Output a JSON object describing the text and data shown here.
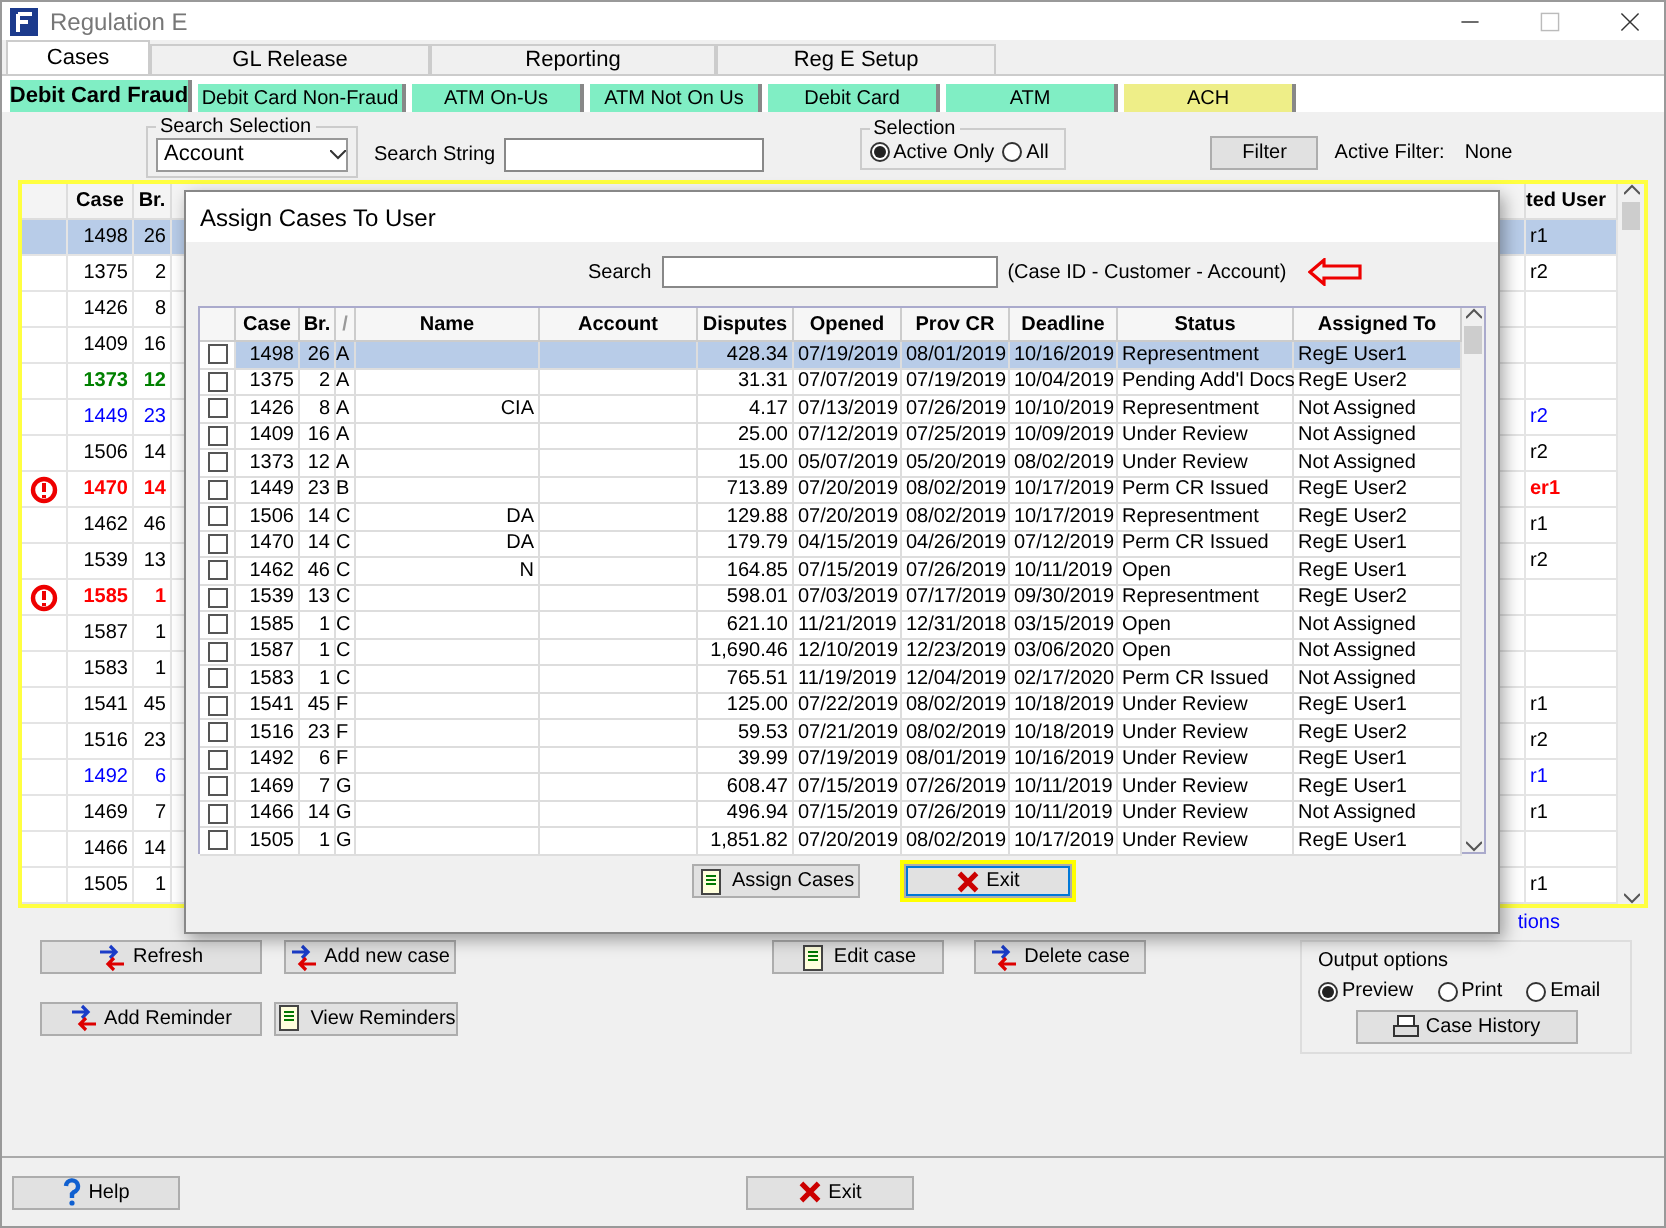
{
  "window": {
    "title": "Regulation E"
  },
  "tabs": [
    {
      "label": "Cases",
      "selected": true
    },
    {
      "label": "GL Release",
      "selected": false
    },
    {
      "label": "Reporting",
      "selected": false
    },
    {
      "label": "Reg E Setup",
      "selected": false
    }
  ],
  "subtabs": [
    {
      "label": "Debit Card Fraud",
      "selected": true,
      "color": "#80eec4"
    },
    {
      "label": "Debit Card Non-Fraud",
      "selected": false,
      "color": "#80eec4"
    },
    {
      "label": "ATM On-Us",
      "selected": false,
      "color": "#80eec4"
    },
    {
      "label": "ATM Not On Us",
      "selected": false,
      "color": "#80eec4"
    },
    {
      "label": "Debit Card",
      "selected": false,
      "color": "#80eec4"
    },
    {
      "label": "ATM",
      "selected": false,
      "color": "#80eec4"
    },
    {
      "label": "ACH",
      "selected": false,
      "color": "#eeee88"
    }
  ],
  "filters": {
    "search_selection": {
      "legend": "Search Selection",
      "value": "Account"
    },
    "search_string": {
      "label": "Search String"
    },
    "selection": {
      "legend": "Selection",
      "options": [
        {
          "label": "Active Only",
          "selected": true
        },
        {
          "label": "All",
          "selected": false
        }
      ]
    },
    "filter_button": "Filter",
    "active_filter": {
      "label": "Active Filter:",
      "value": "None"
    }
  },
  "cases_table": {
    "columns": [
      "Case",
      "Br.",
      "ted User"
    ],
    "rows": [
      {
        "flagged": false,
        "color": "#000000",
        "bold": false,
        "selected": true,
        "case": "1498",
        "br": "26",
        "user": "r1"
      },
      {
        "flagged": false,
        "color": "#000000",
        "bold": false,
        "selected": false,
        "case": "1375",
        "br": "2",
        "user": "r2"
      },
      {
        "flagged": false,
        "color": "#000000",
        "bold": false,
        "selected": false,
        "case": "1426",
        "br": "8",
        "user": ""
      },
      {
        "flagged": false,
        "color": "#000000",
        "bold": false,
        "selected": false,
        "case": "1409",
        "br": "16",
        "user": ""
      },
      {
        "flagged": false,
        "color": "#008000",
        "bold": true,
        "selected": false,
        "case": "1373",
        "br": "12",
        "user": ""
      },
      {
        "flagged": false,
        "color": "#0000ff",
        "bold": false,
        "selected": false,
        "case": "1449",
        "br": "23",
        "user": "r2"
      },
      {
        "flagged": false,
        "color": "#000000",
        "bold": false,
        "selected": false,
        "case": "1506",
        "br": "14",
        "user": "r2"
      },
      {
        "flagged": true,
        "color": "#ff0000",
        "bold": true,
        "selected": false,
        "case": "1470",
        "br": "14",
        "user": "er1"
      },
      {
        "flagged": false,
        "color": "#000000",
        "bold": false,
        "selected": false,
        "case": "1462",
        "br": "46",
        "user": "r1"
      },
      {
        "flagged": false,
        "color": "#000000",
        "bold": false,
        "selected": false,
        "case": "1539",
        "br": "13",
        "user": "r2"
      },
      {
        "flagged": true,
        "color": "#ff0000",
        "bold": true,
        "selected": false,
        "case": "1585",
        "br": "1",
        "user": ""
      },
      {
        "flagged": false,
        "color": "#000000",
        "bold": false,
        "selected": false,
        "case": "1587",
        "br": "1",
        "user": ""
      },
      {
        "flagged": false,
        "color": "#000000",
        "bold": false,
        "selected": false,
        "case": "1583",
        "br": "1",
        "user": ""
      },
      {
        "flagged": false,
        "color": "#000000",
        "bold": false,
        "selected": false,
        "case": "1541",
        "br": "45",
        "user": "r1"
      },
      {
        "flagged": false,
        "color": "#000000",
        "bold": false,
        "selected": false,
        "case": "1516",
        "br": "23",
        "user": "r2"
      },
      {
        "flagged": false,
        "color": "#0000ff",
        "bold": false,
        "selected": false,
        "case": "1492",
        "br": "6",
        "user": "r1"
      },
      {
        "flagged": false,
        "color": "#000000",
        "bold": false,
        "selected": false,
        "case": "1469",
        "br": "7",
        "user": "r1"
      },
      {
        "flagged": false,
        "color": "#000000",
        "bold": false,
        "selected": false,
        "case": "1466",
        "br": "14",
        "user": ""
      },
      {
        "flagged": false,
        "color": "#000000",
        "bold": false,
        "selected": false,
        "case": "1505",
        "br": "1",
        "user": "r1"
      }
    ]
  },
  "options_link": "tions",
  "actions": [
    "Refresh",
    "Add new case",
    "Edit case",
    "Delete case"
  ],
  "reminder_actions": [
    "Add Reminder",
    "View Reminders"
  ],
  "output_options": {
    "legend": "Output options",
    "options": [
      {
        "label": "Preview",
        "selected": true
      },
      {
        "label": "Print",
        "selected": false
      },
      {
        "label": "Email",
        "selected": false
      }
    ],
    "button": "Case History"
  },
  "footer": {
    "help": "Help",
    "exit": "Exit"
  },
  "dialog": {
    "title": "Assign Cases To User",
    "search": {
      "label": "Search",
      "hint": "(Case ID - Customer - Account)"
    },
    "columns": [
      "Case",
      "Br.",
      "/",
      "Name",
      "Account",
      "Disputes",
      "Opened",
      "Prov CR",
      "Deadline",
      "Status",
      "Assigned To"
    ],
    "rows": [
      {
        "checked": false,
        "selected": true,
        "case": "1498",
        "br": "26",
        "initial": "A",
        "name": "",
        "disputes": "428.34",
        "opened": "07/19/2019",
        "prov_cr": "08/01/2019",
        "deadline": "10/16/2019",
        "status": "Representment",
        "assigned_to": "RegE User1"
      },
      {
        "checked": false,
        "selected": false,
        "case": "1375",
        "br": "2",
        "initial": "A",
        "name": "",
        "disputes": "31.31",
        "opened": "07/07/2019",
        "prov_cr": "07/19/2019",
        "deadline": "10/04/2019",
        "status": "Pending Add'l Docs",
        "assigned_to": "RegE User2"
      },
      {
        "checked": false,
        "selected": false,
        "case": "1426",
        "br": "8",
        "initial": "A",
        "name": "CIA",
        "disputes": "4.17",
        "opened": "07/13/2019",
        "prov_cr": "07/26/2019",
        "deadline": "10/10/2019",
        "status": "Representment",
        "assigned_to": "Not Assigned"
      },
      {
        "checked": false,
        "selected": false,
        "case": "1409",
        "br": "16",
        "initial": "A",
        "name": "",
        "disputes": "25.00",
        "opened": "07/12/2019",
        "prov_cr": "07/25/2019",
        "deadline": "10/09/2019",
        "status": "Under Review",
        "assigned_to": "Not Assigned"
      },
      {
        "checked": false,
        "selected": false,
        "case": "1373",
        "br": "12",
        "initial": "A",
        "name": "",
        "disputes": "15.00",
        "opened": "05/07/2019",
        "prov_cr": "05/20/2019",
        "deadline": "08/02/2019",
        "status": "Under Review",
        "assigned_to": "Not Assigned"
      },
      {
        "checked": false,
        "selected": false,
        "case": "1449",
        "br": "23",
        "initial": "B",
        "name": "",
        "disputes": "713.89",
        "opened": "07/20/2019",
        "prov_cr": "08/02/2019",
        "deadline": "10/17/2019",
        "status": "Perm CR Issued",
        "assigned_to": "RegE User2"
      },
      {
        "checked": false,
        "selected": false,
        "case": "1506",
        "br": "14",
        "initial": "C",
        "name": "DA",
        "disputes": "129.88",
        "opened": "07/20/2019",
        "prov_cr": "08/02/2019",
        "deadline": "10/17/2019",
        "status": "Representment",
        "assigned_to": "RegE User2"
      },
      {
        "checked": false,
        "selected": false,
        "case": "1470",
        "br": "14",
        "initial": "C",
        "name": "DA",
        "disputes": "179.79",
        "opened": "04/15/2019",
        "prov_cr": "04/26/2019",
        "deadline": "07/12/2019",
        "status": "Perm CR Issued",
        "assigned_to": "RegE User1"
      },
      {
        "checked": false,
        "selected": false,
        "case": "1462",
        "br": "46",
        "initial": "C",
        "name": "N",
        "disputes": "164.85",
        "opened": "07/15/2019",
        "prov_cr": "07/26/2019",
        "deadline": "10/11/2019",
        "status": "Open",
        "assigned_to": "RegE User1"
      },
      {
        "checked": false,
        "selected": false,
        "case": "1539",
        "br": "13",
        "initial": "C",
        "name": "",
        "disputes": "598.01",
        "opened": "07/03/2019",
        "prov_cr": "07/17/2019",
        "deadline": "09/30/2019",
        "status": "Representment",
        "assigned_to": "RegE User2"
      },
      {
        "checked": false,
        "selected": false,
        "case": "1585",
        "br": "1",
        "initial": "C",
        "name": "",
        "disputes": "621.10",
        "opened": "11/21/2019",
        "prov_cr": "12/31/2018",
        "deadline": "03/15/2019",
        "status": "Open",
        "assigned_to": "Not Assigned"
      },
      {
        "checked": false,
        "selected": false,
        "case": "1587",
        "br": "1",
        "initial": "C",
        "name": "",
        "disputes": "1,690.46",
        "opened": "12/10/2019",
        "prov_cr": "12/23/2019",
        "deadline": "03/06/2020",
        "status": "Open",
        "assigned_to": "Not Assigned"
      },
      {
        "checked": false,
        "selected": false,
        "case": "1583",
        "br": "1",
        "initial": "C",
        "name": "",
        "disputes": "765.51",
        "opened": "11/19/2019",
        "prov_cr": "12/04/2019",
        "deadline": "02/17/2020",
        "status": "Perm CR Issued",
        "assigned_to": "Not Assigned"
      },
      {
        "checked": false,
        "selected": false,
        "case": "1541",
        "br": "45",
        "initial": "F",
        "name": "",
        "disputes": "125.00",
        "opened": "07/22/2019",
        "prov_cr": "08/02/2019",
        "deadline": "10/18/2019",
        "status": "Under Review",
        "assigned_to": "RegE User1"
      },
      {
        "checked": false,
        "selected": false,
        "case": "1516",
        "br": "23",
        "initial": "F",
        "name": "",
        "disputes": "59.53",
        "opened": "07/21/2019",
        "prov_cr": "08/02/2019",
        "deadline": "10/18/2019",
        "status": "Under Review",
        "assigned_to": "RegE User2"
      },
      {
        "checked": false,
        "selected": false,
        "case": "1492",
        "br": "6",
        "initial": "F",
        "name": "",
        "disputes": "39.99",
        "opened": "07/19/2019",
        "prov_cr": "08/01/2019",
        "deadline": "10/16/2019",
        "status": "Under Review",
        "assigned_to": "RegE User1"
      },
      {
        "checked": false,
        "selected": false,
        "case": "1469",
        "br": "7",
        "initial": "G",
        "name": "",
        "disputes": "608.47",
        "opened": "07/15/2019",
        "prov_cr": "07/26/2019",
        "deadline": "10/11/2019",
        "status": "Under Review",
        "assigned_to": "RegE User1"
      },
      {
        "checked": false,
        "selected": false,
        "case": "1466",
        "br": "14",
        "initial": "G",
        "name": "",
        "disputes": "496.94",
        "opened": "07/15/2019",
        "prov_cr": "07/26/2019",
        "deadline": "10/11/2019",
        "status": "Under Review",
        "assigned_to": "Not Assigned"
      },
      {
        "checked": false,
        "selected": false,
        "case": "1505",
        "br": "1",
        "initial": "G",
        "name": "",
        "disputes": "1,851.82",
        "opened": "07/20/2019",
        "prov_cr": "08/02/2019",
        "deadline": "10/17/2019",
        "status": "Under Review",
        "assigned_to": "RegE User1"
      }
    ],
    "buttons": [
      {
        "label": "Assign Cases",
        "default": false
      },
      {
        "label": "Exit",
        "default": true
      }
    ]
  }
}
